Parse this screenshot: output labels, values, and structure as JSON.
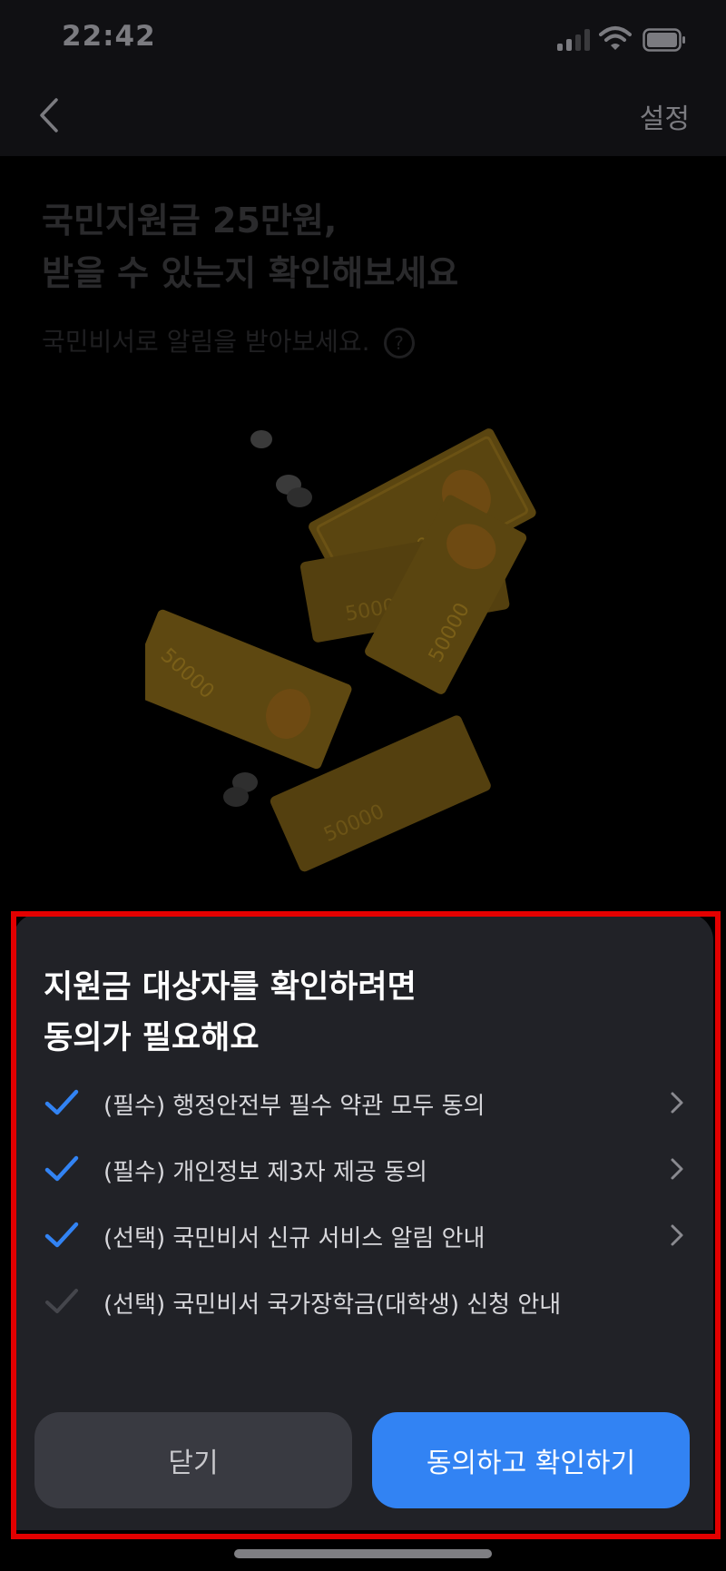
{
  "status_bar": {
    "time": "22:42"
  },
  "nav": {
    "settings_label": "설정"
  },
  "content": {
    "headline_line1": "국민지원금 25만원,",
    "headline_line2": "받을 수 있는지 확인해보세요",
    "subtitle": "국민비서로 알림을 받아보세요.",
    "help_symbol": "?",
    "banknote_value": "50000"
  },
  "sheet": {
    "title_line1": "지원금 대상자를 확인하려면",
    "title_line2": "동의가 필요해요",
    "consents": [
      {
        "label": "(필수) 행정안전부 필수 약관 모두 동의",
        "checked": true,
        "has_chevron": true
      },
      {
        "label": "(필수) 개인정보 제3자 제공 동의",
        "checked": true,
        "has_chevron": true
      },
      {
        "label": "(선택) 국민비서 신규 서비스 알림 안내",
        "checked": true,
        "has_chevron": true
      },
      {
        "label": "(선택) 국민비서 국가장학금(대학생) 신청 안내",
        "checked": false,
        "has_chevron": false
      }
    ],
    "close_label": "닫기",
    "agree_label": "동의하고 확인하기"
  },
  "colors": {
    "accent": "#3283f3",
    "check_on": "#3283f3",
    "check_off": "#45464c",
    "sheet_bg": "#212227",
    "highlight_border": "#e30000"
  }
}
